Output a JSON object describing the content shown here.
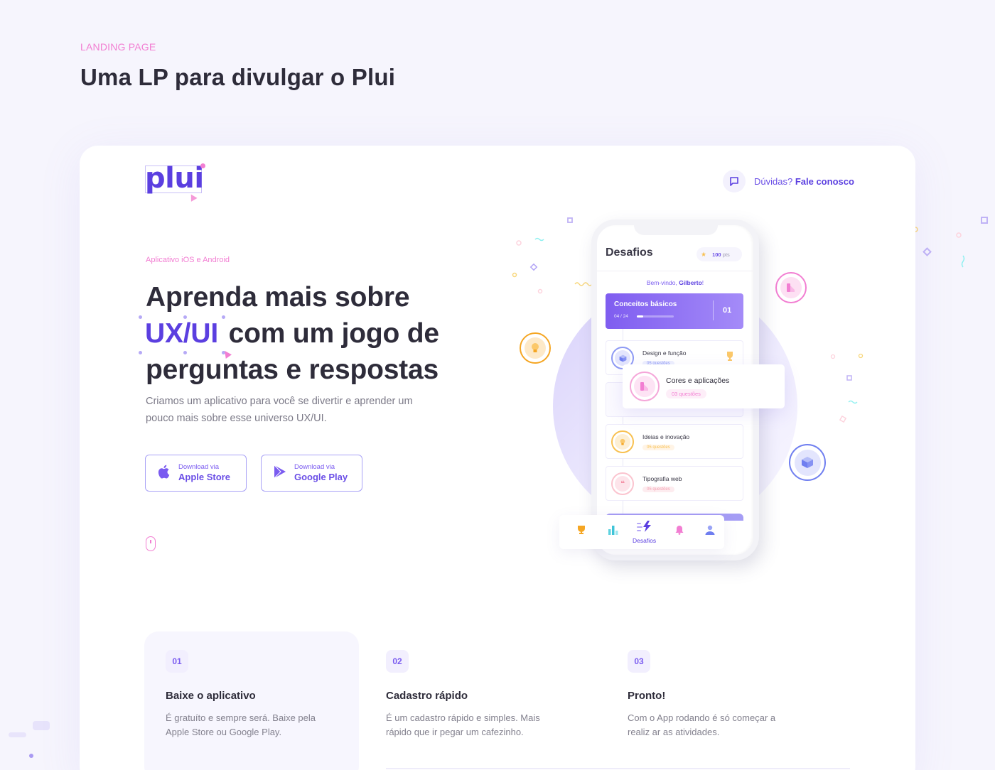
{
  "page": {
    "eyebrow": "LANDING PAGE",
    "title": "Uma LP para divulgar o Plui"
  },
  "colors": {
    "brand_purple": "#5b3fe0",
    "accent_pink": "#f27ed2",
    "background": "#f6f5fd"
  },
  "header": {
    "logo_text": "plui",
    "contact_icon": "chat-bubble-icon",
    "contact_question": "Dúvidas?",
    "contact_link": "Fale conosco"
  },
  "hero": {
    "eyebrow": "Aplicativo iOS e Android",
    "title_line1": "Aprenda mais sobre",
    "title_highlight": "UX/UI",
    "title_line2_rest": "com um jogo de",
    "title_line3": "perguntas e respostas",
    "description": "Criamos um aplicativo para você se divertir e aprender um pouco mais sobre esse universo UX/UI.",
    "buttons": [
      {
        "small": "Download via",
        "big": "Apple Store",
        "icon": "apple-icon"
      },
      {
        "small": "Download via",
        "big": "Google Play",
        "icon": "google-play-icon"
      }
    ],
    "scroll_icon": "mouse-scroll-icon"
  },
  "phone": {
    "title": "Desafios",
    "points_value": "100",
    "points_unit": "pts",
    "welcome_prefix": "Bem-vindo,",
    "welcome_name": "Gilberto",
    "welcome_suffix": "!",
    "current_level": {
      "title": "Conceitos básicos",
      "progress_text": "04 / 24",
      "progress_fraction": 0.167,
      "number": "01"
    },
    "lessons": [
      {
        "title": "Design e função",
        "badge": "05 questões",
        "icon": "cube-icon",
        "has_trophy": true
      },
      {
        "title": "Cores e aplicações",
        "badge": "03 questões",
        "icon": "color-palette-icon"
      },
      {
        "title": "Ideias e inovação",
        "badge": "05 questões",
        "icon": "lightbulb-icon"
      },
      {
        "title": "Tipografia web",
        "badge": "05 questões",
        "icon": "quote-icon"
      }
    ],
    "tabbar": [
      {
        "icon": "trophy-icon",
        "label": ""
      },
      {
        "icon": "bar-chart-icon",
        "label": ""
      },
      {
        "icon": "lightning-icon",
        "label": "Desafios",
        "active": true
      },
      {
        "icon": "bell-icon",
        "label": ""
      },
      {
        "icon": "user-icon",
        "label": ""
      }
    ]
  },
  "steps": [
    {
      "number": "01",
      "title": "Baixe o aplicativo",
      "text": "É gratuíto e sempre será. Baixe pela Apple Store ou Google Play."
    },
    {
      "number": "02",
      "title": "Cadastro rápido",
      "text": "É um cadastro rápido e simples. Mais rápido que ir pegar um cafezinho."
    },
    {
      "number": "03",
      "title": "Pronto!",
      "text": "Com o App rodando é só começar a realiz ar as atividades."
    }
  ]
}
